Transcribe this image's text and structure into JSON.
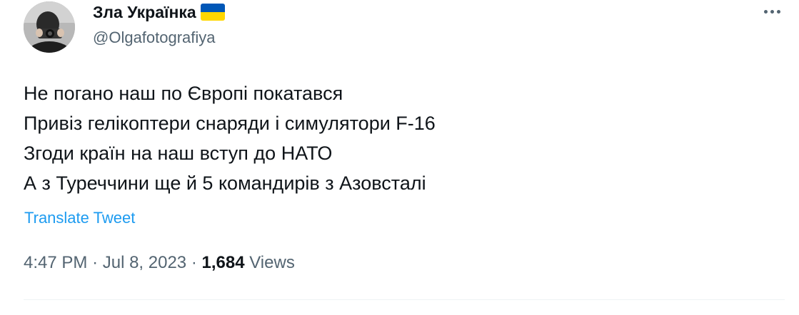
{
  "author": {
    "display_name": "Зла Українка",
    "handle": "@Olgafotografiya",
    "flag_icon": "ukraine-flag-icon",
    "flag_colors": [
      "#0057b7",
      "#ffd700"
    ]
  },
  "more_icon": "more-options-icon",
  "tweet": {
    "lines": [
      "Не погано наш по Європі покатався",
      "Привіз гелікоптери снаряди і симулятори F-16",
      "Згоди країн на наш вступ до НАТО",
      "А з Туреччини ще й 5 командирів з Азовсталі"
    ],
    "translate_label": "Translate Tweet"
  },
  "meta": {
    "time": "4:47 PM",
    "separator": "·",
    "date": "Jul 8, 2023",
    "views_count": "1,684",
    "views_label": "Views"
  },
  "colors": {
    "text": "#0f1419",
    "secondary": "#536471",
    "link": "#1d9bf0",
    "divider": "#eff3f4"
  }
}
